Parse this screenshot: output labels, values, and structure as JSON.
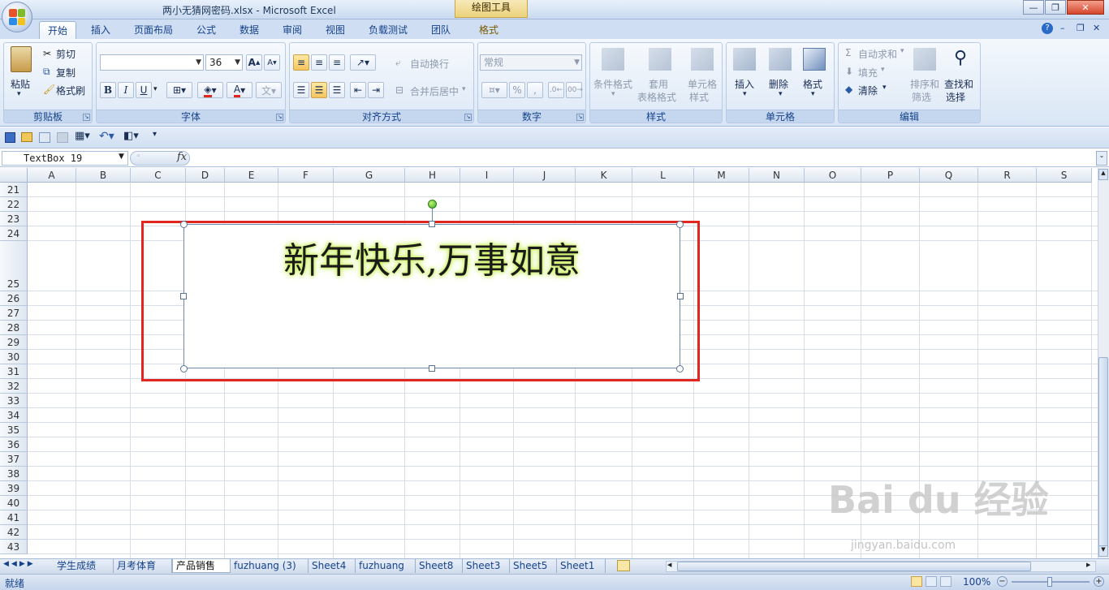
{
  "window": {
    "title": "两小无猜网密码.xlsx - Microsoft Excel",
    "context_tab_title": "绘图工具",
    "controls": {
      "minimize": "—",
      "restore": "❐",
      "close": "✕"
    }
  },
  "ribbon_tabs": [
    "开始",
    "插入",
    "页面布局",
    "公式",
    "数据",
    "审阅",
    "视图",
    "负载测试",
    "团队",
    "格式"
  ],
  "ribbon": {
    "clipboard": {
      "label": "剪贴板",
      "paste": "粘贴",
      "cut": "剪切",
      "copy": "复制",
      "format_painter": "格式刷"
    },
    "font": {
      "label": "字体",
      "font_name": "",
      "font_size": "36",
      "bold": "B",
      "italic": "I",
      "underline": "U",
      "grow": "A",
      "shrink": "A"
    },
    "alignment": {
      "label": "对齐方式",
      "wrap_text": "自动换行",
      "merge_center": "合并后居中"
    },
    "number": {
      "label": "数字",
      "format": "常规",
      "percent": "%",
      "comma": ","
    },
    "styles": {
      "label": "样式",
      "conditional": "条件格式",
      "table_format_1": "套用",
      "table_format_2": "表格格式",
      "cell_style_1": "单元格",
      "cell_style_2": "样式"
    },
    "cells": {
      "label": "单元格",
      "insert": "插入",
      "delete": "删除",
      "format": "格式"
    },
    "editing": {
      "label": "编辑",
      "autosum": "自动求和",
      "fill": "填充",
      "clear": "清除",
      "sort_1": "排序和",
      "sort_2": "筛选",
      "find_1": "查找和",
      "find_2": "选择"
    }
  },
  "formula_bar": {
    "name_box": "TextBox 19",
    "fx": "fx",
    "formula": ""
  },
  "columns": [
    "A",
    "B",
    "C",
    "D",
    "E",
    "F",
    "G",
    "H",
    "I",
    "J",
    "K",
    "L",
    "M",
    "N",
    "O",
    "P",
    "Q",
    "R",
    "S"
  ],
  "rows": [
    "21",
    "22",
    "23",
    "24",
    "25",
    "26",
    "27",
    "28",
    "29",
    "30",
    "31",
    "32",
    "33",
    "34",
    "35",
    "36",
    "37",
    "38",
    "39",
    "40",
    "41",
    "42",
    "43"
  ],
  "textbox": {
    "text": "新年快乐,万事如意"
  },
  "sheet_tabs": [
    "学生成绩",
    "月考体育",
    "产品销售",
    "fuzhuang (3)",
    "Sheet4",
    "fuzhuang",
    "Sheet8",
    "Sheet3",
    "Sheet5",
    "Sheet1"
  ],
  "active_sheet": "产品销售",
  "status": {
    "mode": "就绪",
    "zoom": "100%"
  },
  "watermark": {
    "main": "Bai du 经验",
    "url": "jingyan.baidu.com"
  },
  "colors": {
    "accent": "#15428b",
    "selection_border": "#e0261f",
    "glow": "#c9ef55"
  }
}
